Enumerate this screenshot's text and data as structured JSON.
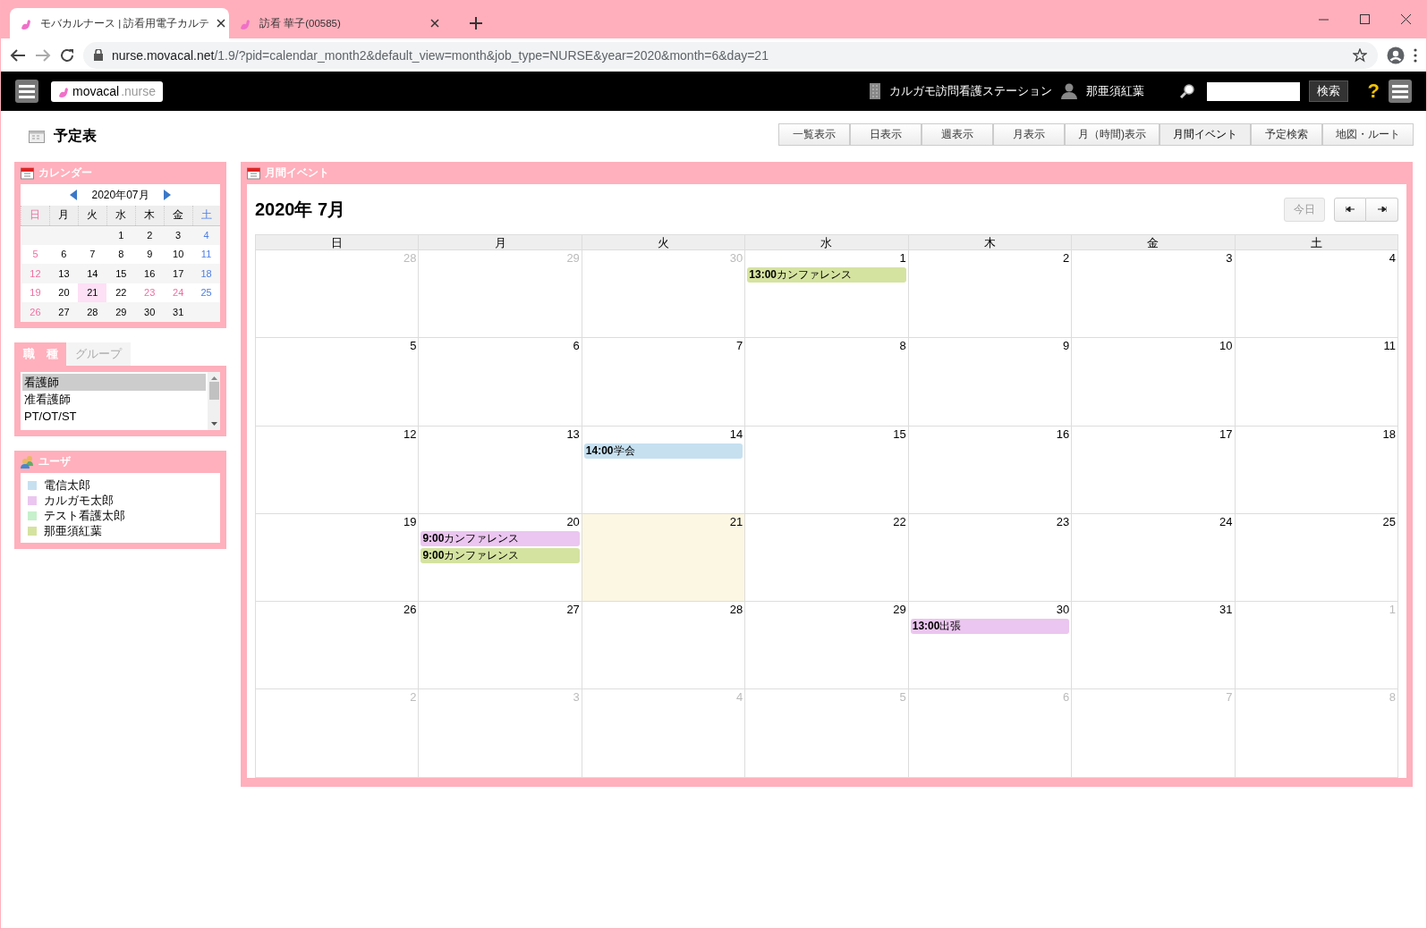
{
  "browser": {
    "tabs": [
      {
        "title": "モバカルナース | 訪看用電子カルテ",
        "selected": true
      },
      {
        "title": "訪看 華子(00585)",
        "selected": false
      }
    ],
    "url_host": "nurse.movacal.net",
    "url_path": "/1.9/?pid=calendar_month2&default_view=month&job_type=NURSE&year=2020&month=6&day=21"
  },
  "header": {
    "logo_main": "movacal",
    "logo_sub": ".nurse",
    "station": "カルガモ訪問看護ステーション",
    "user": "那亜須紅葉",
    "search_button": "検索",
    "help": "?"
  },
  "page_title": "予定表",
  "view_tabs": [
    {
      "label": "一覧表示",
      "selected": false
    },
    {
      "label": "日表示",
      "selected": false
    },
    {
      "label": "週表示",
      "selected": false
    },
    {
      "label": "月表示",
      "selected": false
    },
    {
      "label": "月（時間)表示",
      "selected": false
    },
    {
      "label": "月間イベント",
      "selected": true
    },
    {
      "label": "予定検索",
      "selected": false
    },
    {
      "label": "地図・ルート",
      "selected": false
    }
  ],
  "mini_calendar": {
    "title": "カレンダー",
    "month": "2020年07月",
    "weekdays": [
      {
        "label": "日",
        "kind": "sun"
      },
      {
        "label": "月",
        "kind": "day"
      },
      {
        "label": "火",
        "kind": "day"
      },
      {
        "label": "水",
        "kind": "day"
      },
      {
        "label": "木",
        "kind": "day"
      },
      {
        "label": "金",
        "kind": "day"
      },
      {
        "label": "土",
        "kind": "sat"
      }
    ],
    "weeks": [
      [
        {
          "kind": "blank"
        },
        {
          "kind": "blank"
        },
        {
          "kind": "blank"
        },
        {
          "day": "1",
          "kind": "day",
          "selected": false
        },
        {
          "day": "2",
          "kind": "day",
          "selected": false
        },
        {
          "day": "3",
          "kind": "day",
          "selected": false
        },
        {
          "day": "4",
          "kind": "sat",
          "selected": false
        }
      ],
      [
        {
          "day": "5",
          "kind": "sun",
          "selected": false
        },
        {
          "day": "6",
          "kind": "day",
          "selected": false
        },
        {
          "day": "7",
          "kind": "day",
          "selected": false
        },
        {
          "day": "8",
          "kind": "day",
          "selected": false
        },
        {
          "day": "9",
          "kind": "day",
          "selected": false
        },
        {
          "day": "10",
          "kind": "day",
          "selected": false
        },
        {
          "day": "11",
          "kind": "sat",
          "selected": false
        }
      ],
      [
        {
          "day": "12",
          "kind": "sun",
          "selected": false
        },
        {
          "day": "13",
          "kind": "day",
          "selected": false
        },
        {
          "day": "14",
          "kind": "day",
          "selected": false
        },
        {
          "day": "15",
          "kind": "day",
          "selected": false
        },
        {
          "day": "16",
          "kind": "day",
          "selected": false
        },
        {
          "day": "17",
          "kind": "day",
          "selected": false
        },
        {
          "day": "18",
          "kind": "sat",
          "selected": false
        }
      ],
      [
        {
          "day": "19",
          "kind": "sun",
          "selected": false
        },
        {
          "day": "20",
          "kind": "day",
          "selected": false
        },
        {
          "day": "21",
          "kind": "day",
          "selected": true
        },
        {
          "day": "22",
          "kind": "day",
          "selected": false
        },
        {
          "day": "23",
          "kind": "holiday",
          "selected": false
        },
        {
          "day": "24",
          "kind": "holiday",
          "selected": false
        },
        {
          "day": "25",
          "kind": "sat",
          "selected": false
        }
      ],
      [
        {
          "day": "26",
          "kind": "sun",
          "selected": false
        },
        {
          "day": "27",
          "kind": "day",
          "selected": false
        },
        {
          "day": "28",
          "kind": "day",
          "selected": false
        },
        {
          "day": "29",
          "kind": "day",
          "selected": false
        },
        {
          "day": "30",
          "kind": "day",
          "selected": false
        },
        {
          "day": "31",
          "kind": "day",
          "selected": false
        },
        {
          "kind": "blank"
        }
      ]
    ]
  },
  "filter_tabs": [
    {
      "label": "職　種",
      "selected": true
    },
    {
      "label": "グループ",
      "selected": false
    }
  ],
  "job_types": [
    {
      "label": "看護師",
      "selected": true
    },
    {
      "label": "准看護師",
      "selected": false
    },
    {
      "label": "PT/OT/ST",
      "selected": false
    }
  ],
  "users": {
    "title": "ユーザ",
    "items": [
      {
        "name": "電信太郎",
        "color": "#c6e0f0"
      },
      {
        "name": "カルガモ太郎",
        "color": "#ebc6f0"
      },
      {
        "name": "テスト看護太郎",
        "color": "#c6f0cc"
      },
      {
        "name": "那亜須紅葉",
        "color": "#d5e3a0"
      }
    ]
  },
  "month_view": {
    "title": "月間イベント",
    "heading": "2020年 7月",
    "today_button": "今日",
    "weekdays": [
      "日",
      "月",
      "火",
      "水",
      "木",
      "金",
      "土"
    ],
    "weeks": [
      [
        {
          "day": "28",
          "outside": true,
          "today": false
        },
        {
          "day": "29",
          "outside": true,
          "today": false
        },
        {
          "day": "30",
          "outside": true,
          "today": false
        },
        {
          "day": "1",
          "outside": false,
          "today": false,
          "events": [
            {
              "time": "13:00",
              "title": "カンファレンス",
              "color": "#d5e3a0"
            }
          ]
        },
        {
          "day": "2",
          "outside": false,
          "today": false
        },
        {
          "day": "3",
          "outside": false,
          "today": false
        },
        {
          "day": "4",
          "outside": false,
          "today": false
        }
      ],
      [
        {
          "day": "5",
          "outside": false,
          "today": false
        },
        {
          "day": "6",
          "outside": false,
          "today": false
        },
        {
          "day": "7",
          "outside": false,
          "today": false
        },
        {
          "day": "8",
          "outside": false,
          "today": false
        },
        {
          "day": "9",
          "outside": false,
          "today": false
        },
        {
          "day": "10",
          "outside": false,
          "today": false
        },
        {
          "day": "11",
          "outside": false,
          "today": false
        }
      ],
      [
        {
          "day": "12",
          "outside": false,
          "today": false
        },
        {
          "day": "13",
          "outside": false,
          "today": false
        },
        {
          "day": "14",
          "outside": false,
          "today": false,
          "events": [
            {
              "time": "14:00",
              "title": "学会",
              "color": "#c6e0f0"
            }
          ]
        },
        {
          "day": "15",
          "outside": false,
          "today": false
        },
        {
          "day": "16",
          "outside": false,
          "today": false
        },
        {
          "day": "17",
          "outside": false,
          "today": false
        },
        {
          "day": "18",
          "outside": false,
          "today": false
        }
      ],
      [
        {
          "day": "19",
          "outside": false,
          "today": false
        },
        {
          "day": "20",
          "outside": false,
          "today": false,
          "events": [
            {
              "time": "9:00",
              "title": "カンファレンス",
              "color": "#ebc6f0"
            },
            {
              "time": "9:00",
              "title": "カンファレンス",
              "color": "#d5e3a0"
            }
          ]
        },
        {
          "day": "21",
          "outside": false,
          "today": true
        },
        {
          "day": "22",
          "outside": false,
          "today": false
        },
        {
          "day": "23",
          "outside": false,
          "today": false
        },
        {
          "day": "24",
          "outside": false,
          "today": false
        },
        {
          "day": "25",
          "outside": false,
          "today": false
        }
      ],
      [
        {
          "day": "26",
          "outside": false,
          "today": false
        },
        {
          "day": "27",
          "outside": false,
          "today": false
        },
        {
          "day": "28",
          "outside": false,
          "today": false
        },
        {
          "day": "29",
          "outside": false,
          "today": false
        },
        {
          "day": "30",
          "outside": false,
          "today": false,
          "events": [
            {
              "time": "13:00",
              "title": "出張",
              "color": "#ebc6f0"
            }
          ]
        },
        {
          "day": "31",
          "outside": false,
          "today": false
        },
        {
          "day": "1",
          "outside": true,
          "today": false
        }
      ],
      [
        {
          "day": "2",
          "outside": true,
          "today": false
        },
        {
          "day": "3",
          "outside": true,
          "today": false
        },
        {
          "day": "4",
          "outside": true,
          "today": false
        },
        {
          "day": "5",
          "outside": true,
          "today": false
        },
        {
          "day": "6",
          "outside": true,
          "today": false
        },
        {
          "day": "7",
          "outside": true,
          "today": false
        },
        {
          "day": "8",
          "outside": true,
          "today": false
        }
      ]
    ]
  }
}
